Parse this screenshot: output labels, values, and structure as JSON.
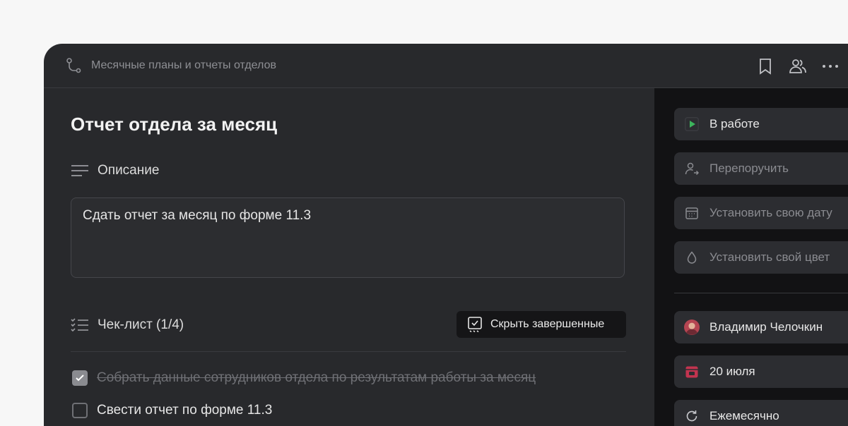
{
  "topbar": {
    "breadcrumb": "Месячные планы и отчеты отделов",
    "icons": [
      "route-icon",
      "bookmark-icon",
      "users-icon",
      "more-icon"
    ]
  },
  "task": {
    "title": "Отчет отдела за месяц",
    "description_label": "Описание",
    "description_text": "Сдать отчет за месяц по форме 11.3",
    "checklist_label": "Чек-лист (1/4)",
    "hide_completed_label": "Скрыть завершенные",
    "checklist_items": [
      {
        "text": "Собрать данные сотрудников отдела по результатам работы за месяц",
        "done": true
      },
      {
        "text": "Свести отчет по форме 11.3",
        "done": false
      }
    ]
  },
  "sidebar": {
    "status": "В работе",
    "reassign": "Перепоручить",
    "set_date": "Установить свою дату",
    "set_color": "Установить свой цвет",
    "assignee": "Владимир Челочкин",
    "due_date": "20 июля",
    "repeat": "Ежемесячно"
  },
  "colors": {
    "status_green": "#3cb45c",
    "date_red": "#c2344f",
    "window_bg": "#28292c",
    "sidebar_bg": "#121214"
  }
}
